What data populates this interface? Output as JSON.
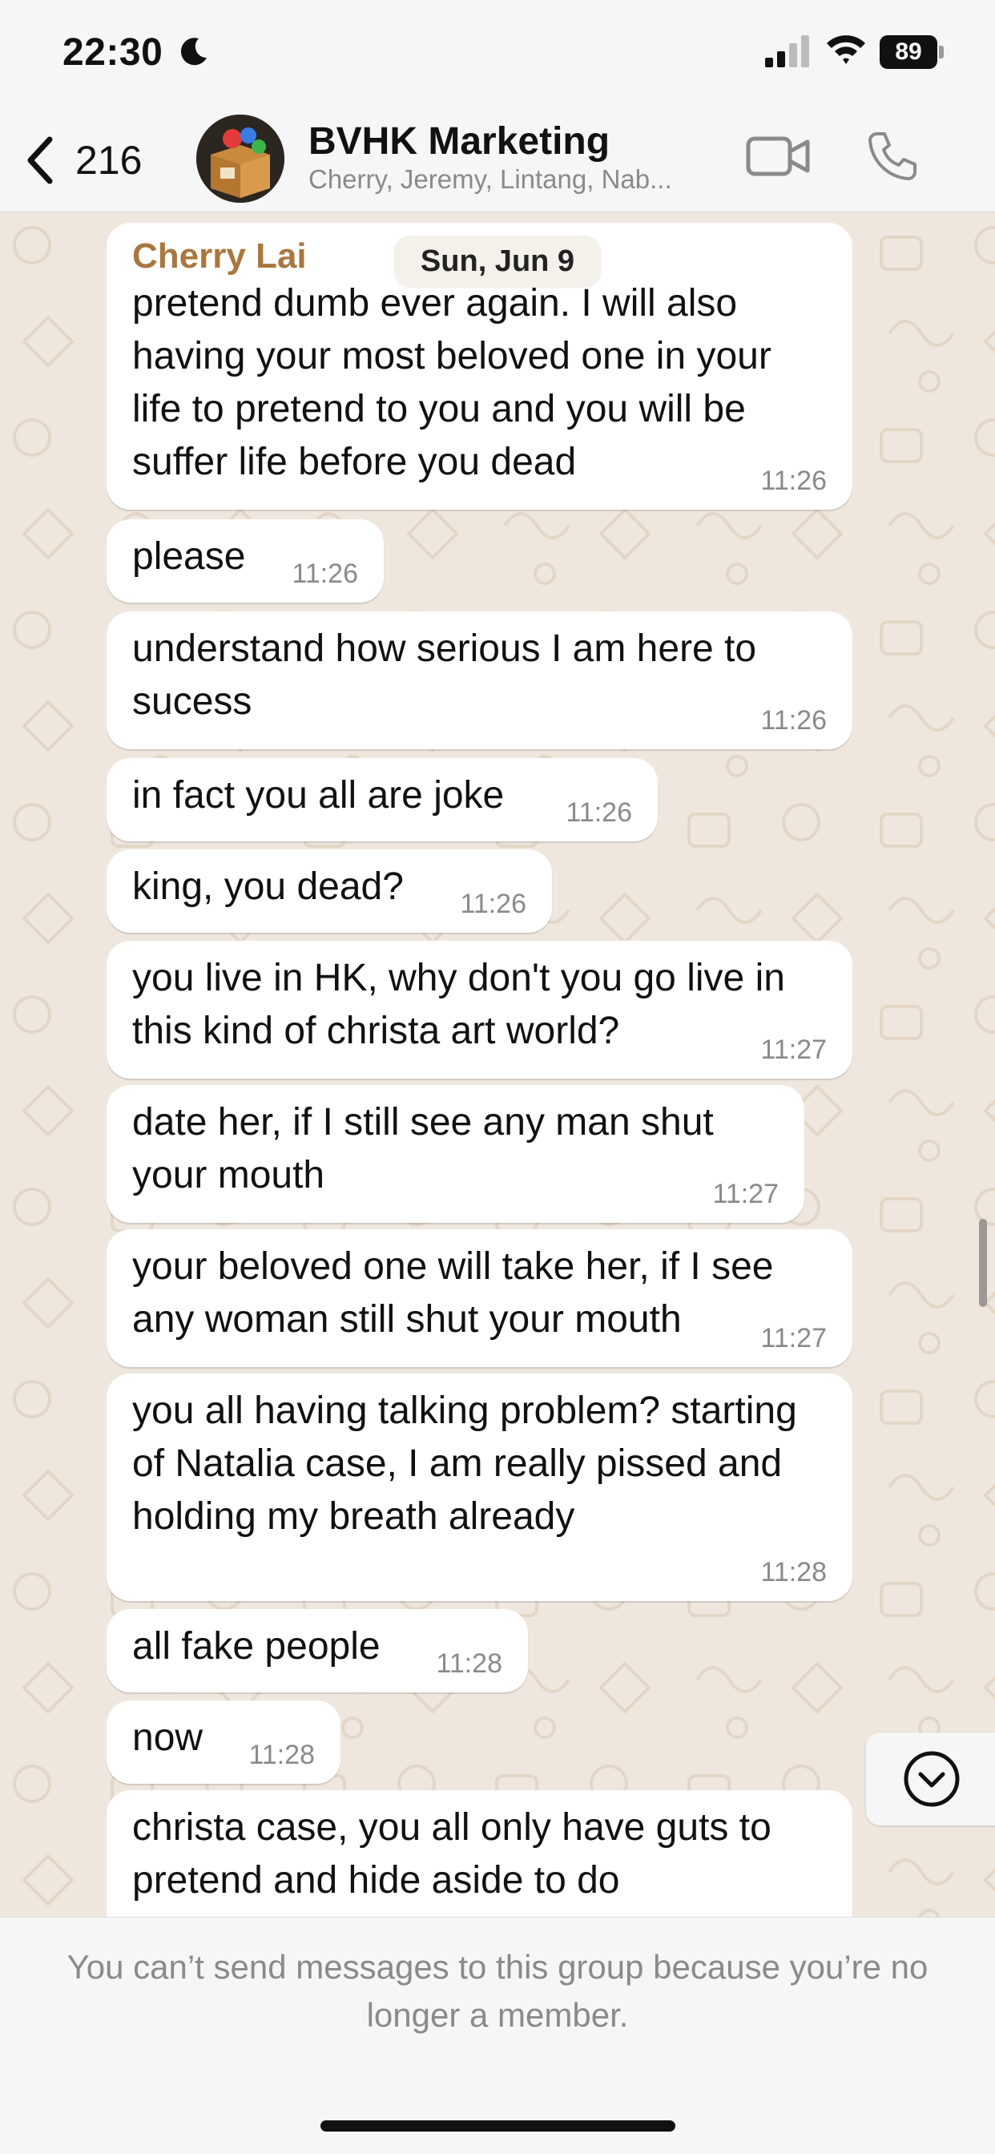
{
  "status_bar": {
    "time": "22:30",
    "battery": "89"
  },
  "header": {
    "back_count": "216",
    "group_name": "BVHK Marketing",
    "members": "Cherry, Jeremy, Lintang, Nab..."
  },
  "date_chip": "Sun, Jun 9",
  "messages": [
    {
      "sender": "Cherry Lai",
      "text": "pretend dumb ever again. I will also having your most beloved one in your life to pretend to you and you will be suffer life before you dead",
      "time": "11:26"
    },
    {
      "text": "please",
      "time": "11:26"
    },
    {
      "text": "understand how serious I am here to sucess",
      "time": "11:26"
    },
    {
      "text": "in fact you all are joke",
      "time": "11:26"
    },
    {
      "text": "king, you dead?",
      "time": "11:26"
    },
    {
      "text": "you live in HK, why don't you go live in this kind of christa art world?",
      "time": "11:27"
    },
    {
      "text": "date her, if I still see any man shut your mouth",
      "time": "11:27"
    },
    {
      "text": "your beloved one will take her, if I see any woman still shut your mouth",
      "time": "11:27"
    },
    {
      "text": "you all having talking problem? starting of Natalia case, I am really pissed and holding my breath already",
      "time": "11:28"
    },
    {
      "text": "all fake people",
      "time": "11:28"
    },
    {
      "text": "now",
      "time": "11:28"
    },
    {
      "text": "christa case, you all only have guts to pretend and hide aside to do",
      "time": ""
    }
  ],
  "footer_notice": "You can’t send messages to this group because you’re no longer a member.",
  "icons": {
    "moon": "moon-icon",
    "signal": "signal-icon",
    "wifi": "wifi-icon",
    "back": "chevron-left-icon",
    "video": "video-camera-icon",
    "phone": "phone-icon",
    "scroll_down": "chevron-down-circle-icon"
  },
  "colors": {
    "sender_name": "#a9773e",
    "chat_background": "#efe7de",
    "bubble": "#ffffff"
  }
}
